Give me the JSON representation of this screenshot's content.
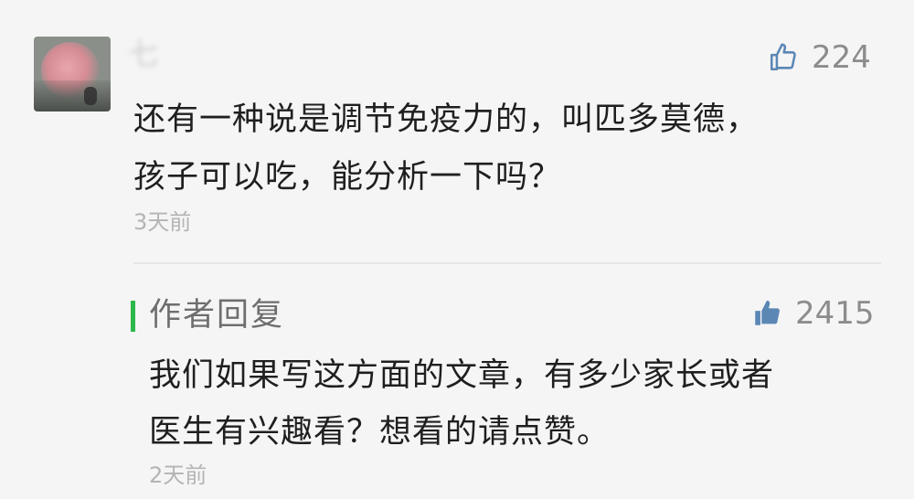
{
  "comment": {
    "username": "七",
    "like_count": "224",
    "text_lines": [
      "还有一种说是调节免疫力的，叫匹多莫德，",
      "孩子可以吃，能分析一下吗？"
    ],
    "time": "3天前"
  },
  "reply": {
    "title": "作者回复",
    "like_count": "2415",
    "text_lines": [
      "我们如果写这方面的文章，有多少家长或者",
      "医生有兴趣看？想看的请点赞。"
    ],
    "time": "2天前"
  },
  "colors": {
    "accent_green": "#2bb84a",
    "liked_blue": "#5b87b5",
    "unliked_gray": "#8c8c8c"
  },
  "icons": {
    "comment_like": "thumbs-up-outline",
    "reply_like": "thumbs-up-filled"
  }
}
